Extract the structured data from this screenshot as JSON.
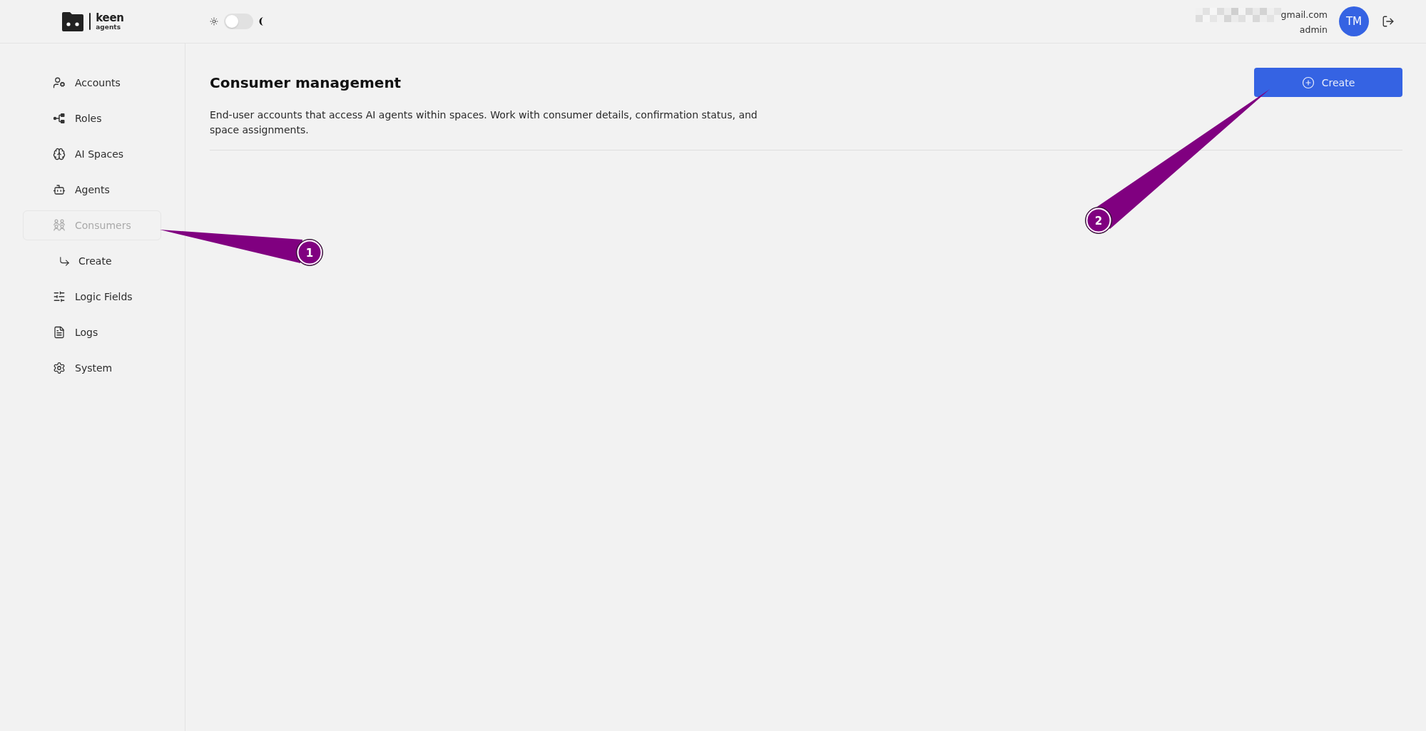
{
  "header": {
    "logo": {
      "wordmark": "keen",
      "tagline": "agents"
    },
    "theme_toggle": {
      "on": false
    },
    "user": {
      "email_redacted": true,
      "email": "gmail.com",
      "role": "admin",
      "initials": "TM"
    }
  },
  "sidebar": {
    "items": [
      {
        "label": "Accounts",
        "selected": false
      },
      {
        "label": "Roles",
        "selected": false
      },
      {
        "label": "AI Spaces",
        "selected": false
      },
      {
        "label": "Agents",
        "selected": false
      },
      {
        "label": "Consumers",
        "selected": true,
        "children": [
          {
            "label": "Create",
            "selected": false
          }
        ]
      },
      {
        "label": "Logic Fields",
        "selected": false
      },
      {
        "label": "Logs",
        "selected": false
      },
      {
        "label": "System",
        "selected": false
      }
    ]
  },
  "main": {
    "title": "Consumer management",
    "description": "End-user accounts that access AI agents within spaces. Work with consumer details, confirmation status, and space assignments.",
    "create_button": {
      "label": "Create"
    }
  },
  "callouts": [
    {
      "label": "1"
    },
    {
      "label": "2"
    }
  ]
}
